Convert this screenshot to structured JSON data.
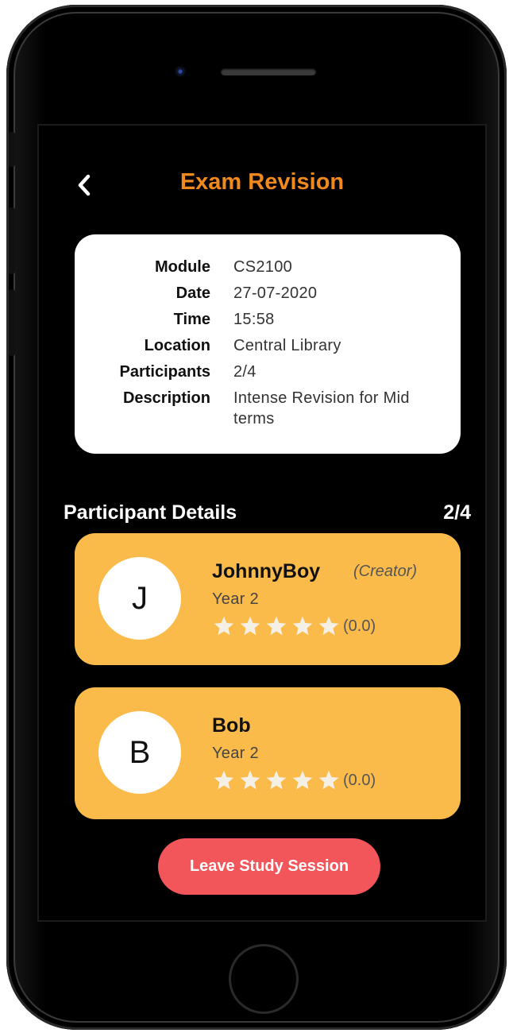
{
  "header": {
    "title": "Exam Revision"
  },
  "session": {
    "rows": [
      {
        "label": "Module",
        "value": "CS2100"
      },
      {
        "label": "Date",
        "value": "27-07-2020"
      },
      {
        "label": "Time",
        "value": "15:58"
      },
      {
        "label": "Location",
        "value": "Central Library"
      },
      {
        "label": "Participants",
        "value": "2/4"
      },
      {
        "label": "Description",
        "value": "Intense Revision for Mid terms"
      }
    ]
  },
  "participants": {
    "title": "Participant Details",
    "count": "2/4",
    "list": [
      {
        "initial": "J",
        "name": "JohnnyBoy",
        "role": "(Creator)",
        "year": "Year 2",
        "rating_text": "(0.0)",
        "rating": 0
      },
      {
        "initial": "B",
        "name": "Bob",
        "role": "",
        "year": "Year 2",
        "rating_text": "(0.0)",
        "rating": 0
      }
    ]
  },
  "actions": {
    "leave_label": "Leave Study Session"
  },
  "icons": {
    "back": "chevron-left-icon",
    "star": "star-icon"
  },
  "colors": {
    "title": "#f08a1c",
    "participant_card": "#fbbb4a",
    "leave_button": "#f2555a",
    "star": "#f5f0e6"
  }
}
